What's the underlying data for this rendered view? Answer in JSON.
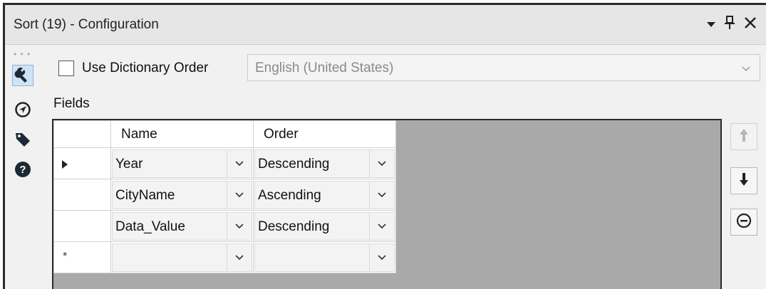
{
  "window": {
    "title": "Sort (19) - Configuration",
    "dropdown_icon": "triangle-down-icon",
    "pin_icon": "pin-icon",
    "close_icon": "close-icon"
  },
  "sidebar": {
    "items": [
      {
        "icon": "wrench-icon",
        "active": true
      },
      {
        "icon": "compass-icon",
        "active": false
      },
      {
        "icon": "tag-icon",
        "active": false
      },
      {
        "icon": "help-icon",
        "active": false
      }
    ]
  },
  "dictionary": {
    "checkbox_label": "Use Dictionary Order",
    "checked": false,
    "language_value": "English (United States)"
  },
  "fields": {
    "label": "Fields",
    "columns": [
      "Name",
      "Order"
    ],
    "rows": [
      {
        "name": "Year",
        "order": "Descending",
        "current": true
      },
      {
        "name": "CityName",
        "order": "Ascending",
        "current": false
      },
      {
        "name": "Data_Value",
        "order": "Descending",
        "current": false
      },
      {
        "name": "",
        "order": "",
        "new_row_marker": "*"
      }
    ]
  },
  "actions": {
    "move_up": "arrow-up-icon",
    "move_down": "arrow-down-icon",
    "remove": "remove-circle-icon"
  },
  "colors": {
    "grid_background": "#a9a9a9",
    "active_tab": "#cfe3f7"
  }
}
